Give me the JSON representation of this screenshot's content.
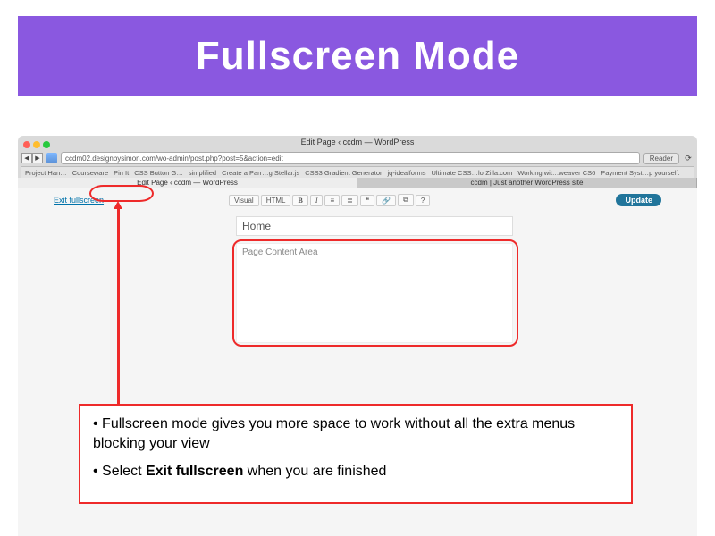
{
  "slide_title": "Fullscreen Mode",
  "browser": {
    "window_title": "Edit Page ‹ ccdm — WordPress",
    "url": "ccdm02.designbysimon.com/wo-admin/post.php?post=5&action=edit",
    "reader_label": "Reader",
    "bookmarks": [
      "Project Han…",
      "Courseware",
      "Pin It",
      "CSS Button G…",
      "simplified",
      "Create a Parr…g Stellar.js",
      "CSS3 Gradient Generator",
      "jq-idealforms",
      "Ultimate CSS…lorZilla.com",
      "Working wit…weaver CS6",
      "Payment Syst…p yourself."
    ],
    "tabs": [
      "Edit Page ‹ ccdm — WordPress",
      "ccdm | Just another WordPress site"
    ]
  },
  "editor": {
    "exit_link": "Exit fullscreen",
    "tabs": {
      "visual": "Visual",
      "html": "HTML"
    },
    "buttons": {
      "bold": "B",
      "italic": "I",
      "ul": "≡",
      "ol": "≣",
      "quote": "❝",
      "link": "🔗",
      "img": "⧉",
      "help": "?"
    },
    "update": "Update",
    "page_title": "Home",
    "content_placeholder": "Page Content Area"
  },
  "notes": {
    "bullet1_prefix": "• Fullscreen mode gives you more space to work without all the extra menus blocking your view",
    "bullet2_prefix": "• Select ",
    "bullet2_bold": "Exit fullscreen",
    "bullet2_suffix": " when you are finished"
  }
}
